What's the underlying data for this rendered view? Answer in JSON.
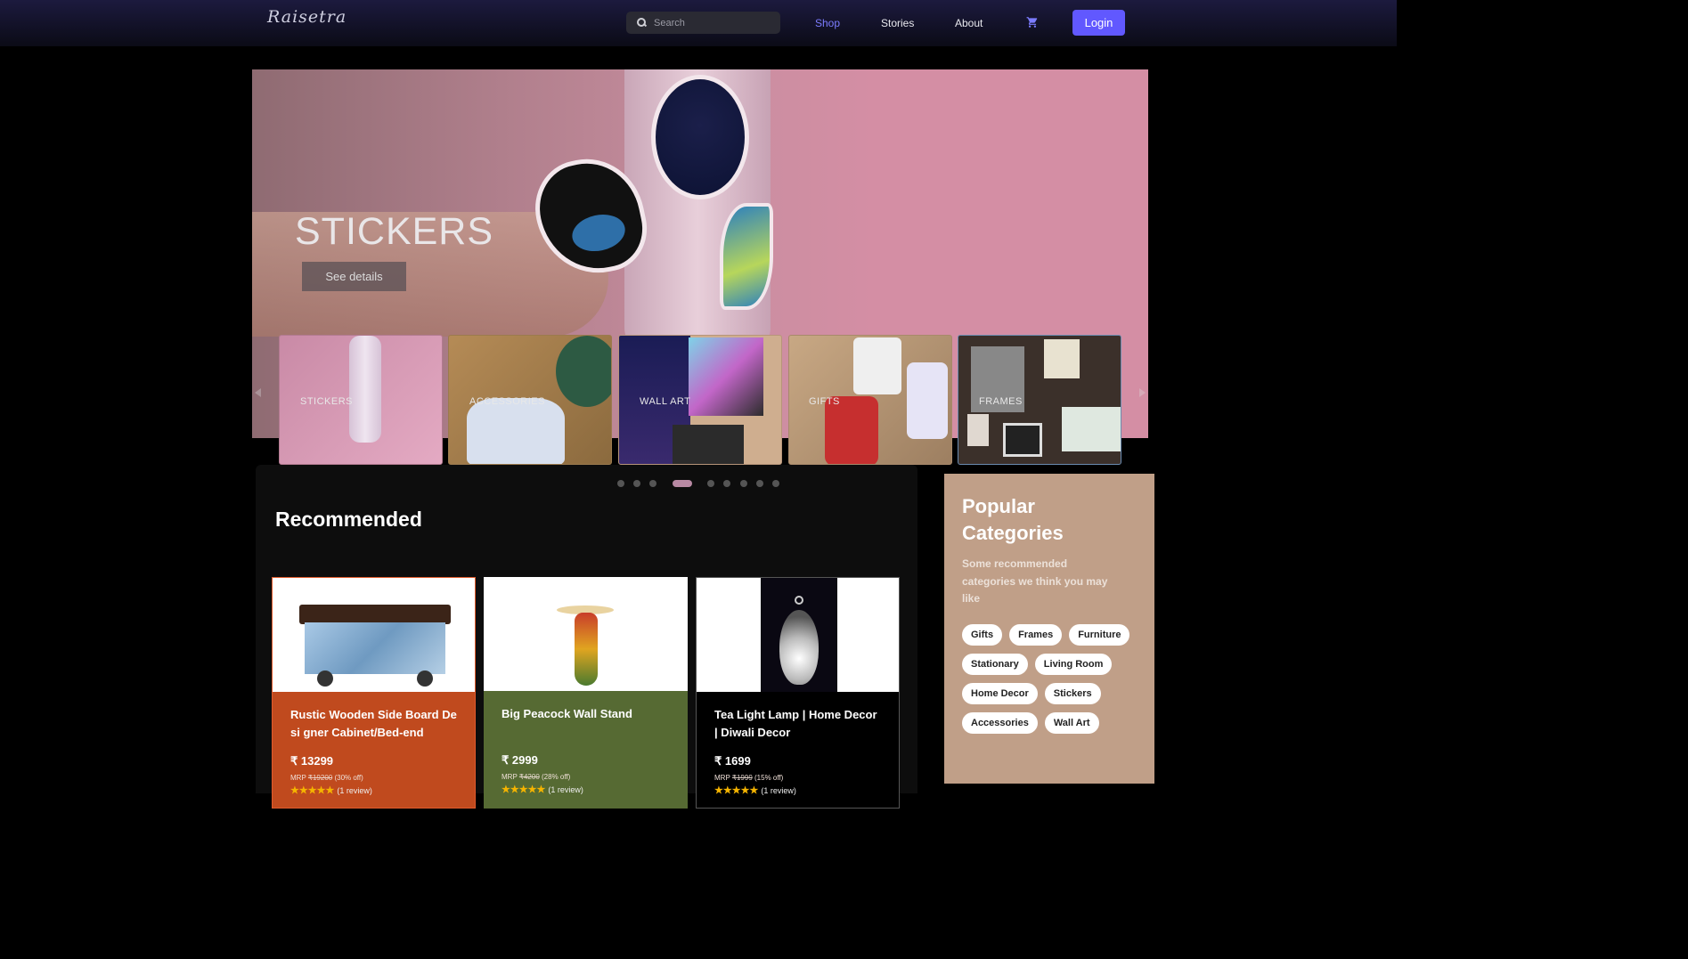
{
  "nav": {
    "logo": "Raisetra",
    "search_placeholder": "Search",
    "links": [
      "Shop",
      "Stories",
      "About"
    ],
    "active_link": "Shop",
    "login_label": "Login",
    "accent": "#6158ff"
  },
  "hero": {
    "title": "STICKERS",
    "cta": "See details",
    "background": "#d48ea4"
  },
  "carousel": {
    "items": [
      "STICKERS",
      "ACCESSORIES",
      "WALL ART",
      "GIFTS",
      "FRAMES"
    ],
    "dot_count": 9,
    "active_dot": 4
  },
  "recommended": {
    "title": "Recommended",
    "products": [
      {
        "name": "Rustic Wooden Side Board Desi gner Cabinet/Bed-end",
        "price": "₹ 13299",
        "mrp_label": "MRP",
        "mrp": "₹19200",
        "discount": "(30% off)",
        "stars": "★★★★★",
        "reviews": "(1 review)",
        "color": "#c04a1e"
      },
      {
        "name": "Big Peacock Wall Stand",
        "price": "₹ 2999",
        "mrp_label": "MRP",
        "mrp": "₹4200",
        "discount": "(28% off)",
        "stars": "★★★★★",
        "reviews": "(1 review)",
        "color": "#566a33"
      },
      {
        "name": "Tea Light Lamp | Home Decor | Diwali Decor",
        "price": "₹ 1699",
        "mrp_label": "MRP",
        "mrp": "₹1999",
        "discount": "(15% off)",
        "stars": "★★★★★",
        "reviews": "(1 review)",
        "color": "#000000"
      }
    ]
  },
  "popular": {
    "title": "Popular Categories",
    "subtitle": "Some recommended categories we think you may like",
    "categories": [
      "Gifts",
      "Frames",
      "Furniture",
      "Stationary",
      "Living Room",
      "Home Decor",
      "Stickers",
      "Accessories",
      "Wall Art"
    ],
    "background": "#c09f88"
  }
}
